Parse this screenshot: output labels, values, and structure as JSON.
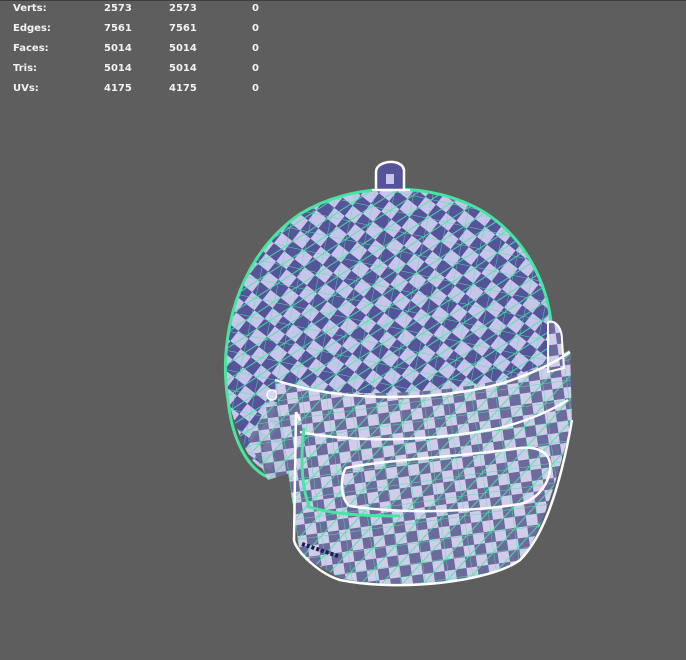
{
  "hud": {
    "rows": [
      {
        "label": "Verts:",
        "a": "2573",
        "b": "2573",
        "c": "0"
      },
      {
        "label": "Edges:",
        "a": "7561",
        "b": "7561",
        "c": "0"
      },
      {
        "label": "Faces:",
        "a": "5014",
        "b": "5014",
        "c": "0"
      },
      {
        "label": "Tris:",
        "a": "5014",
        "b": "5014",
        "c": "0"
      },
      {
        "label": "UVs:",
        "a": "4175",
        "b": "4175",
        "c": "0"
      }
    ]
  },
  "colors": {
    "background": "#5e5e5e",
    "wire": "#46e6a2",
    "selection_outline": "#ffffff",
    "checker_light": "#c6c3ea",
    "checker_dark": "#55539a"
  },
  "model": {
    "icon": "helmet-mesh-icon"
  }
}
